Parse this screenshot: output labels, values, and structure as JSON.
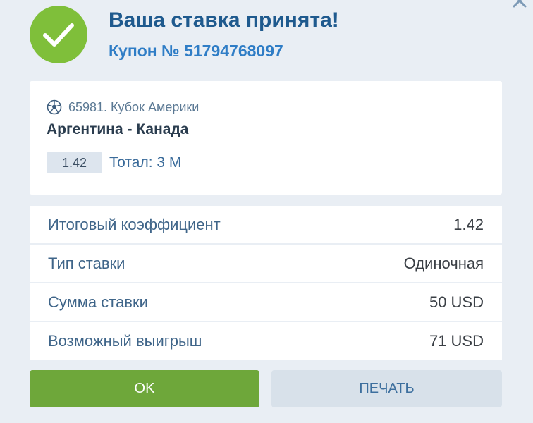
{
  "dialog": {
    "title": "Ваша ставка принята!",
    "coupon": "Купон № 51794768097",
    "close_icon": "close-icon",
    "success_icon": "checkmark-icon"
  },
  "event": {
    "sport_icon": "soccer-ball-icon",
    "league": "65981. Кубок Америки",
    "match": "Аргентина - Канада",
    "odds": "1.42",
    "market": "Тотал: 3 М"
  },
  "details": [
    {
      "label": "Итоговый коэффициент",
      "value": "1.42"
    },
    {
      "label": "Тип ставки",
      "value": "Одиночная"
    },
    {
      "label": "Сумма ставки",
      "value": "50 USD"
    },
    {
      "label": "Возможный выигрыш",
      "value": "71 USD"
    }
  ],
  "buttons": {
    "ok": "OK",
    "print": "ПЕЧАТЬ"
  },
  "colors": {
    "success_green": "#7fbf3a",
    "ok_button": "#6ea73a",
    "title_blue": "#1f5a8e",
    "coupon_blue": "#2f7dc6",
    "background": "#e9eef4"
  }
}
